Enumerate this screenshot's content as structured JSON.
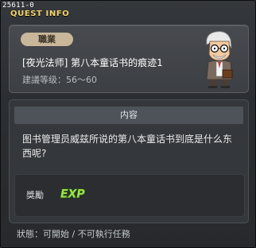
{
  "window": {
    "quest_id": "25611-0",
    "title": "QUEST INFO"
  },
  "quest": {
    "job_tag": "職業",
    "title": "[夜光法师] 第八本童话书的痕迹1",
    "level": "建議等级：56～60",
    "npc_icon": "librarian-npc-icon"
  },
  "content": {
    "header": "内容",
    "description": "图书管理员威兹所说的第八本童话书到底是什么东西呢?",
    "reward_label": "獎勵",
    "reward_icon": "exp-icon",
    "reward_icon_text": "EXP"
  },
  "status": {
    "text": "狀態：可開始 / 不可執行任務"
  },
  "colors": {
    "title_gold": "#f3d36b",
    "job_tag_bg": "#c9b79a",
    "exp_green": "#9be14b"
  }
}
